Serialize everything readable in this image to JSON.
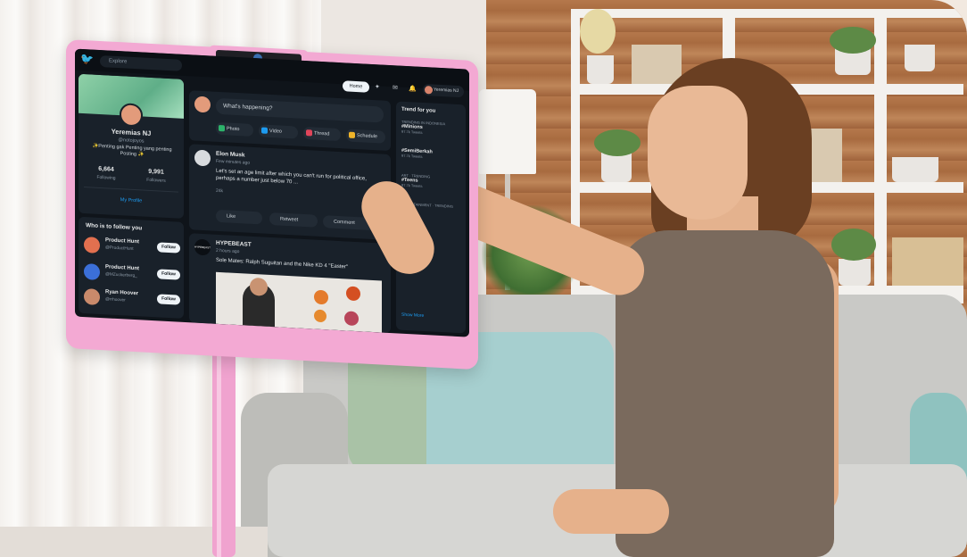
{
  "twitter": {
    "search_placeholder": "Explore",
    "nav": {
      "home": "Home",
      "user": "Yeremias NJ"
    },
    "profile": {
      "name": "Yeremias NJ",
      "handle": "@notojoyos",
      "bio": "✨Penting gak Penting yang penting Posting ✨",
      "following_count": "6,664",
      "following_label": "Following",
      "followers_count": "9,991",
      "followers_label": "Followers",
      "link": "My Profile"
    },
    "who_to_follow": {
      "title": "Who is to follow you",
      "users": [
        {
          "name": "Product Hunt",
          "handle": "@ProductHunt",
          "button": "Follow",
          "color": "#e2704f"
        },
        {
          "name": "Product Hunt",
          "handle": "@MZuckerberg_",
          "button": "Follow",
          "color": "#3b6fd8"
        },
        {
          "name": "Ryan Hoover",
          "handle": "@rrhoover",
          "button": "Follow",
          "color": "#c98a6b"
        }
      ]
    },
    "composer": {
      "placeholder": "What's happening?",
      "buttons": [
        {
          "label": "Photo",
          "color": "#2db36b"
        },
        {
          "label": "Video",
          "color": "#1d9bf0"
        },
        {
          "label": "Thread",
          "color": "#e0455a"
        },
        {
          "label": "Schedule",
          "color": "#f0b429"
        }
      ]
    },
    "posts": [
      {
        "author": "Elon Musk",
        "handle": "@elonmusk",
        "time": "Few minutes ago",
        "text": "Let's set an age limit after which you can't run for political office, perhaps a number just below 70 ...",
        "likes": "24k",
        "actions": [
          "Like",
          "Retweet",
          "Comment"
        ]
      },
      {
        "author": "HYPEBEAST",
        "handle": "@HYPEBEAST",
        "time": "2 hours ago",
        "text": "Sole Mates: Ralph Suguitan and the Nike KD 4 \"Easter\"",
        "logo": "HYPEBEAST"
      }
    ],
    "trends": {
      "title": "Trend for you",
      "items": [
        {
          "category": "TRENDING IN INDONESIA",
          "tag": "#Minions",
          "count": "97.7k Tweets"
        },
        {
          "category": "",
          "tag": "#SemiBerkah",
          "count": "97.7k Tweets"
        },
        {
          "category": "ART · TRENDING",
          "tag": "#Teens",
          "count": "97.7k Tweets"
        },
        {
          "category": "ENTERTAINMENT · TRENDING",
          "tag": "",
          "count": ""
        }
      ],
      "more": "Show More"
    }
  }
}
